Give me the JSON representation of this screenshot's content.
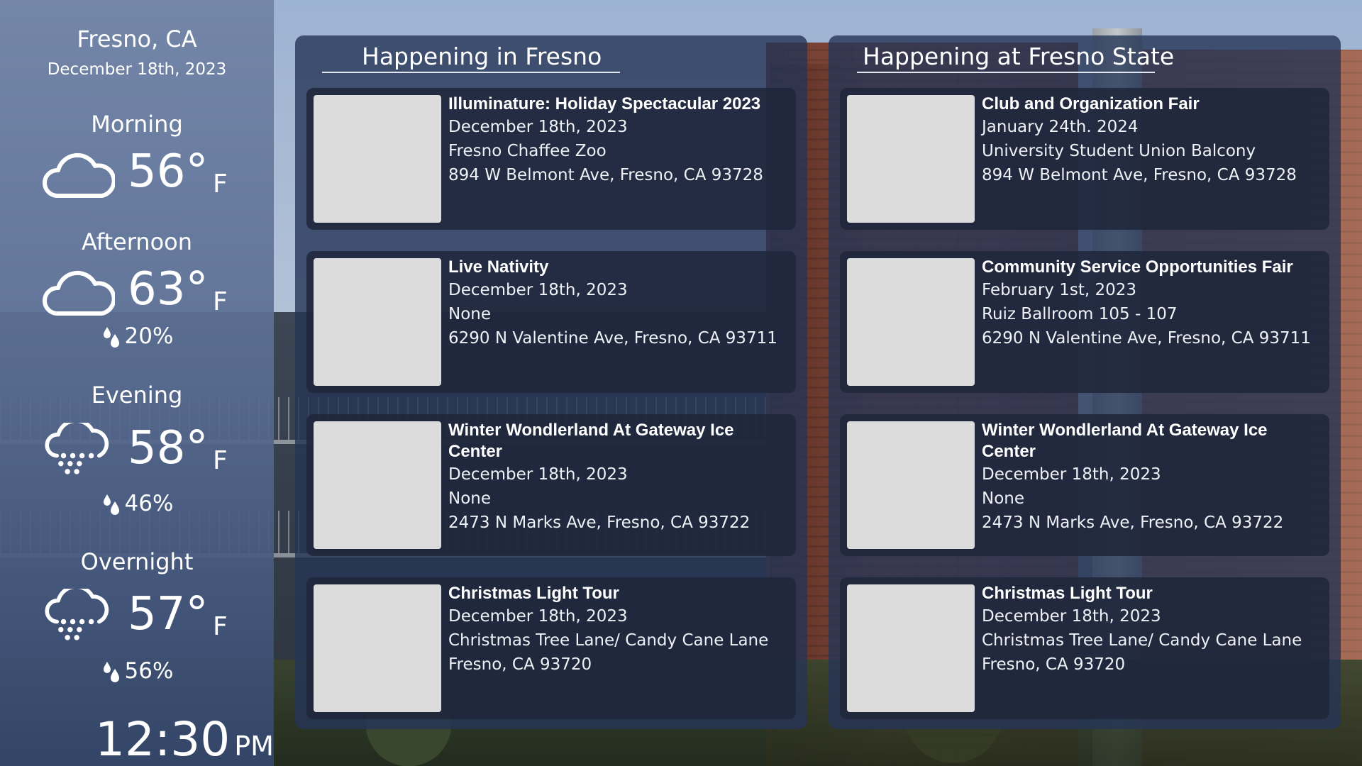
{
  "weather": {
    "city": "Fresno, CA",
    "date": "December 18th, 2023",
    "periods": [
      {
        "label": "Morning",
        "icon": "cloud-icon",
        "temp": "56°",
        "unit": "F",
        "precip": ""
      },
      {
        "label": "Afternoon",
        "icon": "cloud-icon",
        "temp": "63°",
        "unit": "F",
        "precip": "20%"
      },
      {
        "label": "Evening",
        "icon": "rain-cloud-icon",
        "temp": "58°",
        "unit": "F",
        "precip": "46%"
      },
      {
        "label": "Overnight",
        "icon": "rain-cloud-icon",
        "temp": "57°",
        "unit": "F",
        "precip": "56%"
      }
    ],
    "clock": {
      "time": "12:30",
      "ampm": "PM"
    }
  },
  "panels": {
    "city": {
      "title": "Happening in Fresno",
      "events": [
        {
          "title": "Illuminature: Holiday Spectacular 2023",
          "date": "December 18th, 2023",
          "venue": "Fresno Chaffee Zoo",
          "address": "894 W Belmont Ave, Fresno, CA 93728"
        },
        {
          "title": "Live Nativity",
          "date": "December 18th, 2023",
          "venue": "None",
          "address": "6290 N Valentine Ave, Fresno, CA 93711"
        },
        {
          "title": "Winter Wondlerland At Gateway Ice Center",
          "date": "December 18th, 2023",
          "venue": "None",
          "address": "2473 N Marks Ave, Fresno, CA 93722"
        },
        {
          "title": "Christmas Light Tour",
          "date": "December 18th, 2023",
          "venue": "Christmas Tree Lane/ Candy Cane Lane",
          "address": "Fresno, CA 93720"
        }
      ]
    },
    "campus": {
      "title": "Happening at Fresno State",
      "events": [
        {
          "title": "Club and Organization Fair",
          "date": "January 24th. 2024",
          "venue": "University Student Union Balcony",
          "address": "894 W Belmont Ave, Fresno, CA 93728"
        },
        {
          "title": "Community Service Opportunities Fair",
          "date": "February 1st, 2023",
          "venue": "Ruiz Ballroom 105 - 107",
          "address": "6290 N Valentine Ave, Fresno, CA 93711"
        },
        {
          "title": "Winter Wondlerland At Gateway Ice Center",
          "date": "December 18th, 2023",
          "venue": "None",
          "address": "2473 N Marks Ave, Fresno, CA 93722"
        },
        {
          "title": "Christmas Light Tour",
          "date": "December 18th, 2023",
          "venue": "Christmas Tree Lane/ Candy Cane Lane",
          "address": "Fresno, CA 93720"
        }
      ]
    }
  }
}
